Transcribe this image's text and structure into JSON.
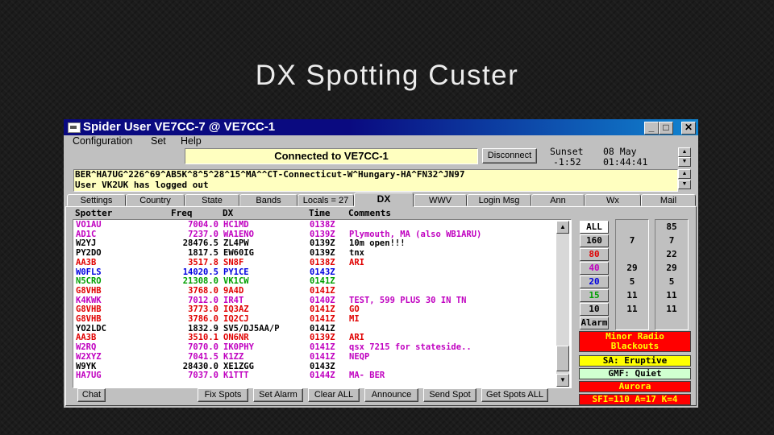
{
  "slide": {
    "title": "DX Spotting Custer"
  },
  "window": {
    "title": "Spider User VE7CC-7 @ VE7CC-1",
    "controls": {
      "minimize": "_",
      "maximize": "□",
      "close": "✕"
    }
  },
  "menu": [
    "Configuration",
    "Set",
    "Help"
  ],
  "status": {
    "connection": "Connected to VE7CC-1",
    "disconnect_label": "Disconnect",
    "sunset_label": "Sunset",
    "sunset_value": "-1:52",
    "date": "08 May",
    "time": "01:44:41"
  },
  "info_lines": [
    "BER^HA7UG^226^69^AB5K^8^5^28^15^MA^^CT-Connecticut-W^Hungary-HA^FN32^JN97",
    "User VK2UK has logged out"
  ],
  "tabs": [
    "Settings",
    "Country",
    "State",
    "Bands",
    "Locals = 27",
    "DX",
    "WWV",
    "Login Msg",
    "Ann",
    "Wx",
    "Mail"
  ],
  "active_tab": "DX",
  "spots": {
    "headers": {
      "spotter": "Spotter",
      "freq": "Freq",
      "dx": "DX",
      "time": "Time",
      "comments": "Comments"
    },
    "rows": [
      {
        "spotter": "VO1AU",
        "freq": "7004.0",
        "dx": "HC1MD",
        "time": "0138Z",
        "comment": "",
        "color": "#c000c0"
      },
      {
        "spotter": "AD1C",
        "freq": "7237.0",
        "dx": "WA1ENO",
        "time": "0139Z",
        "comment": "Plymouth, MA (also WB1ARU)",
        "color": "#c000c0"
      },
      {
        "spotter": "W2YJ",
        "freq": "28476.5",
        "dx": "ZL4PW",
        "time": "0139Z",
        "comment": "10m open!!!",
        "color": "#000000"
      },
      {
        "spotter": "PY2DO",
        "freq": "1817.5",
        "dx": "EW60IG",
        "time": "0139Z",
        "comment": "tnx",
        "color": "#000000"
      },
      {
        "spotter": "AA3B",
        "freq": "3517.8",
        "dx": "SN8F",
        "time": "0138Z",
        "comment": "ARI",
        "color": "#e00000"
      },
      {
        "spotter": "W0FLS",
        "freq": "14020.5",
        "dx": "PY1CE",
        "time": "0143Z",
        "comment": "",
        "color": "#0000e0"
      },
      {
        "spotter": "N5CRO",
        "freq": "21308.0",
        "dx": "VK1CW",
        "time": "0141Z",
        "comment": "",
        "color": "#00a000"
      },
      {
        "spotter": "G8VHB",
        "freq": "3768.0",
        "dx": "9A4D",
        "time": "0141Z",
        "comment": "",
        "color": "#e00000"
      },
      {
        "spotter": "K4KWK",
        "freq": "7012.0",
        "dx": "IR4T",
        "time": "0140Z",
        "comment": "TEST, 599 PLUS 30 IN TN",
        "color": "#c000c0"
      },
      {
        "spotter": "G8VHB",
        "freq": "3773.0",
        "dx": "IQ3AZ",
        "time": "0141Z",
        "comment": "GO",
        "color": "#e00000"
      },
      {
        "spotter": "G8VHB",
        "freq": "3786.0",
        "dx": "IQ2CJ",
        "time": "0141Z",
        "comment": "MI",
        "color": "#e00000"
      },
      {
        "spotter": "YO2LDC",
        "freq": "1832.9",
        "dx": "SV5/DJ5AA/P",
        "time": "0141Z",
        "comment": "",
        "color": "#000000"
      },
      {
        "spotter": "AA3B",
        "freq": "3510.1",
        "dx": "ON6NR",
        "time": "0139Z",
        "comment": "ARI",
        "color": "#e00000"
      },
      {
        "spotter": "W2RQ",
        "freq": "7070.0",
        "dx": "IK0PHY",
        "time": "0141Z",
        "comment": "qsx 7215 for stateside..",
        "color": "#c000c0"
      },
      {
        "spotter": "W2XYZ",
        "freq": "7041.5",
        "dx": "K1ZZ",
        "time": "0141Z",
        "comment": "NEQP",
        "color": "#c000c0"
      },
      {
        "spotter": "W9YK",
        "freq": "28430.0",
        "dx": "XE1ZGG",
        "time": "0143Z",
        "comment": "",
        "color": "#000000"
      },
      {
        "spotter": "HA7UG",
        "freq": "7037.0",
        "dx": "K1TTT",
        "time": "0144Z",
        "comment": "MA-  BER",
        "color": "#c000c0"
      }
    ]
  },
  "bands": [
    {
      "label": "ALL",
      "c1": "",
      "c2": "85",
      "color": "#000000",
      "selected": true
    },
    {
      "label": "160",
      "c1": "7",
      "c2": "7",
      "color": "#000000"
    },
    {
      "label": "80",
      "c1": "",
      "c2": "22",
      "color": "#e00000"
    },
    {
      "label": "40",
      "c1": "29",
      "c2": "29",
      "color": "#c000c0"
    },
    {
      "label": "20",
      "c1": "5",
      "c2": "5",
      "color": "#0000e0"
    },
    {
      "label": "15",
      "c1": "11",
      "c2": "11",
      "color": "#00a000"
    },
    {
      "label": "10",
      "c1": "11",
      "c2": "11",
      "color": "#000000"
    },
    {
      "label": "Alarm",
      "c1": "",
      "c2": "",
      "color": "#000000"
    }
  ],
  "conditions": [
    {
      "text": "Minor Radio Blackouts",
      "bg": "#ff0000",
      "fg": "#ffff00"
    },
    {
      "text": "SA: Eruptive",
      "bg": "#ffff00",
      "fg": "#000000"
    },
    {
      "text": "GMF: Quiet",
      "bg": "#d0ffd0",
      "fg": "#000000"
    },
    {
      "text": "Aurora",
      "bg": "#ff0000",
      "fg": "#ffff00"
    },
    {
      "text": "SFI=110 A=17 K=4",
      "bg": "#ff0000",
      "fg": "#ffff00"
    }
  ],
  "bottom_buttons": [
    "Chat",
    "Fix Spots",
    "Set Alarm",
    "Clear ALL",
    "Announce",
    "Send Spot",
    "Get Spots ALL"
  ]
}
